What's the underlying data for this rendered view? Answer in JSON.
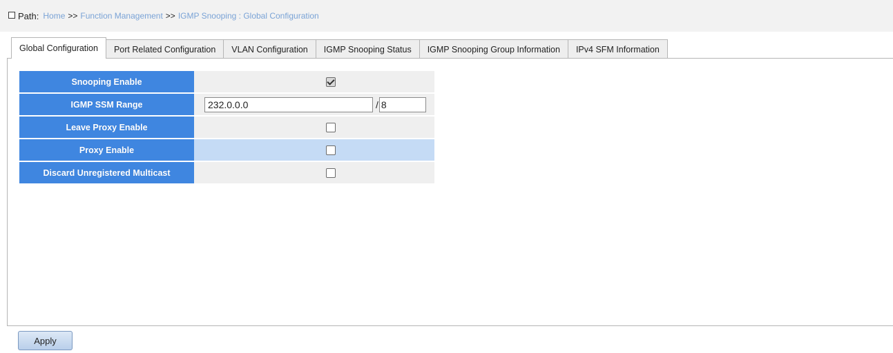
{
  "path": {
    "label": "Path:",
    "crumbs": [
      "Home",
      "Function Management",
      "IGMP Snooping : Global Configuration"
    ],
    "separator": ">>"
  },
  "tabs": [
    {
      "label": "Global Configuration",
      "active": true
    },
    {
      "label": "Port Related Configuration",
      "active": false
    },
    {
      "label": "VLAN Configuration",
      "active": false
    },
    {
      "label": "IGMP Snooping Status",
      "active": false
    },
    {
      "label": "IGMP Snooping Group Information",
      "active": false
    },
    {
      "label": "IPv4 SFM Information",
      "active": false
    }
  ],
  "form": {
    "snooping_enable": {
      "label": "Snooping Enable",
      "checked": true
    },
    "ssm_range": {
      "label": "IGMP SSM Range",
      "ip": "232.0.0.0",
      "slash": "/",
      "mask": "8"
    },
    "leave_proxy_enable": {
      "label": "Leave Proxy Enable",
      "checked": false
    },
    "proxy_enable": {
      "label": "Proxy Enable",
      "checked": false
    },
    "discard_unregistered_multicast": {
      "label": "Discard Unregistered Multicast",
      "checked": false
    }
  },
  "apply_label": "Apply",
  "colors": {
    "label_bg": "#3f86e0",
    "value_bg": "#efefef",
    "highlight_bg": "#c5dbf5",
    "crumb_link": "#7aa3d6"
  }
}
